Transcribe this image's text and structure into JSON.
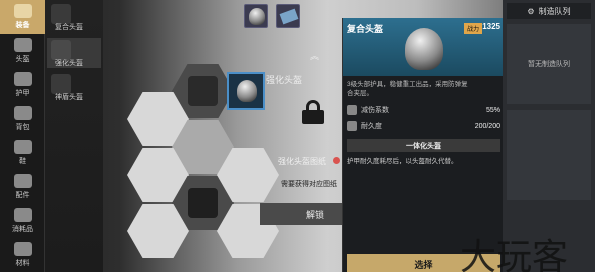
{
  "categories": [
    {
      "label": "装备",
      "active": true
    },
    {
      "label": "头盔",
      "active": false
    },
    {
      "label": "护甲",
      "active": false
    },
    {
      "label": "背包",
      "active": false
    },
    {
      "label": "鞋",
      "active": false
    },
    {
      "label": "配件",
      "active": false
    },
    {
      "label": "消耗品",
      "active": false
    },
    {
      "label": "材料",
      "active": false
    }
  ],
  "subcategories": [
    {
      "label": "复合头盔"
    },
    {
      "label": "强化头盔"
    },
    {
      "label": "神盾头盔"
    }
  ],
  "center": {
    "item_title": "强化头盔",
    "blueprint_label": "强化头盔图纸",
    "requirement": "需要获得对应图纸",
    "unlock_label": "解锁"
  },
  "detail": {
    "title": "复合头盔",
    "power_label": "战力",
    "power_value": "1325",
    "description": "3级头部护具，稳健重工出品，采用防弹复\n合夹层。",
    "stats": [
      {
        "icon": "shield-icon",
        "label": "减伤系数",
        "value": "55%"
      },
      {
        "icon": "wrench-icon",
        "label": "耐久度",
        "value": "200/200"
      }
    ],
    "perk_title": "一体化头盔",
    "perk_desc": "护甲耐久度耗尽后，以头盔耐久代替。",
    "select_label": "选择"
  },
  "queue": {
    "title": "制造队列",
    "empty": "暂无制造队列"
  },
  "watermark": "大玩客"
}
